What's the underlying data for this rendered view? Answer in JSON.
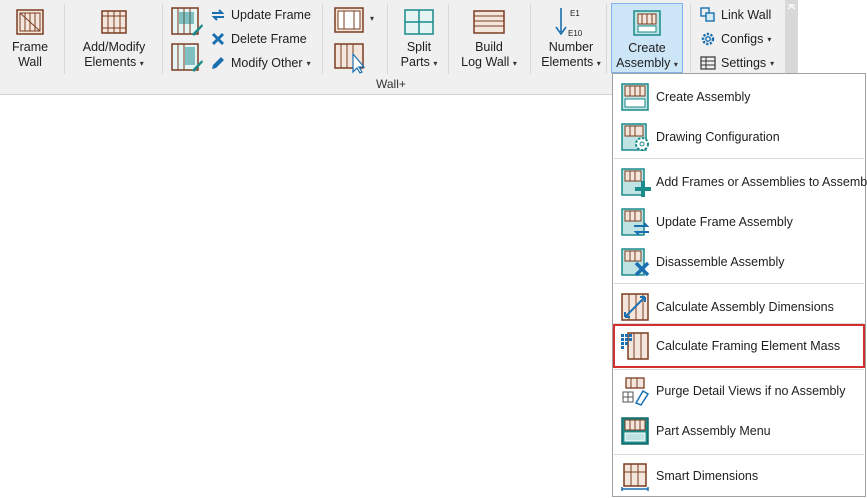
{
  "ribbon": {
    "group_label": "Wall+",
    "frame_wall": [
      "Frame",
      "Wall"
    ],
    "add_modify": [
      "Add/Modify",
      "Elements"
    ],
    "update_frame": "Update Frame",
    "delete_frame": "Delete Frame",
    "modify_other": "Modify Other",
    "split_parts": [
      "Split",
      "Parts"
    ],
    "build_log_wall": [
      "Build",
      "Log Wall"
    ],
    "number_elements": [
      "Number",
      "Elements"
    ],
    "number_tags": [
      "E1",
      "E10"
    ],
    "create_assembly": [
      "Create",
      "Assembly"
    ],
    "link_wall": "Link Wall",
    "configs": "Configs",
    "settings": "Settings",
    "caret": "▾"
  },
  "menu": {
    "items": [
      {
        "label": "Create  Assembly",
        "icon": "assembly-icon"
      },
      {
        "label": "Drawing Configuration",
        "icon": "drawing-config-icon"
      },
      {
        "label": "Add Frames or Assemblies to Assembly",
        "icon": "add-to-assembly-icon"
      },
      {
        "label": "Update Frame Assembly",
        "icon": "update-assembly-icon"
      },
      {
        "label": "Disassemble Assembly",
        "icon": "disassemble-icon"
      },
      {
        "label": "Calculate Assembly Dimensions",
        "icon": "dimensions-icon"
      },
      {
        "label": "Calculate Framing Element Mass",
        "icon": "mass-icon"
      },
      {
        "label": "Purge Detail Views if no Assembly",
        "icon": "purge-icon"
      },
      {
        "label": "Part Assembly Menu",
        "icon": "part-assembly-icon"
      },
      {
        "label": "Smart Dimensions",
        "icon": "smart-dimensions-icon"
      }
    ]
  },
  "colors": {
    "accent": "#1a8a8a",
    "brown": "#8b4a2b",
    "highlight": "#d32f2f"
  }
}
